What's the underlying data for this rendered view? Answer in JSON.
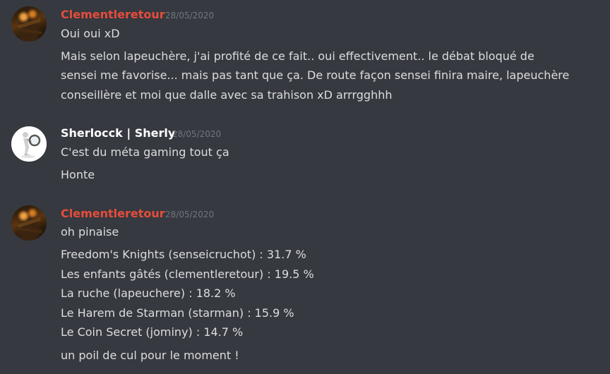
{
  "messages": [
    {
      "author": "Clementleretour",
      "timestamp": "28/05/2020",
      "avatar": "fireplace-photo",
      "lines": [
        "Oui oui xD",
        "Mais selon lapeuchère, j'ai profité de ce fait.. oui effectivement.. le débat bloqué de",
        "sensei me favorise... mais pas tant que ça. De route façon sensei finira maire, lapeuchère",
        "conseillère et moi que dalle avec sa trahison xD arrrgghhh"
      ]
    },
    {
      "author": "Sherlocck | Sherly",
      "timestamp": "28/05/2020",
      "avatar": "magnifying-glass-figure",
      "lines": [
        "C'est du méta gaming tout ça",
        "Honte"
      ]
    },
    {
      "author": "Clementleretour",
      "timestamp": "28/05/2020",
      "avatar": "fireplace-photo",
      "lines": [
        "oh pinaise",
        "Freedom's Knights (senseicruchot) : 31.7 %",
        "Les enfants gâtés (clementleretour) : 19.5 %",
        "La ruche (lapeuchere) : 18.2 %",
        "Le Harem de Starman (starman) : 15.9 %",
        "Le Coin Secret (jominy) : 14.7 %",
        "un poil de cul pour le moment !"
      ]
    }
  ],
  "colors": {
    "background": "#36393f",
    "author_red": "#e74c3c",
    "author_white": "#ffffff",
    "text": "#dcddde",
    "timestamp": "#72767d"
  }
}
